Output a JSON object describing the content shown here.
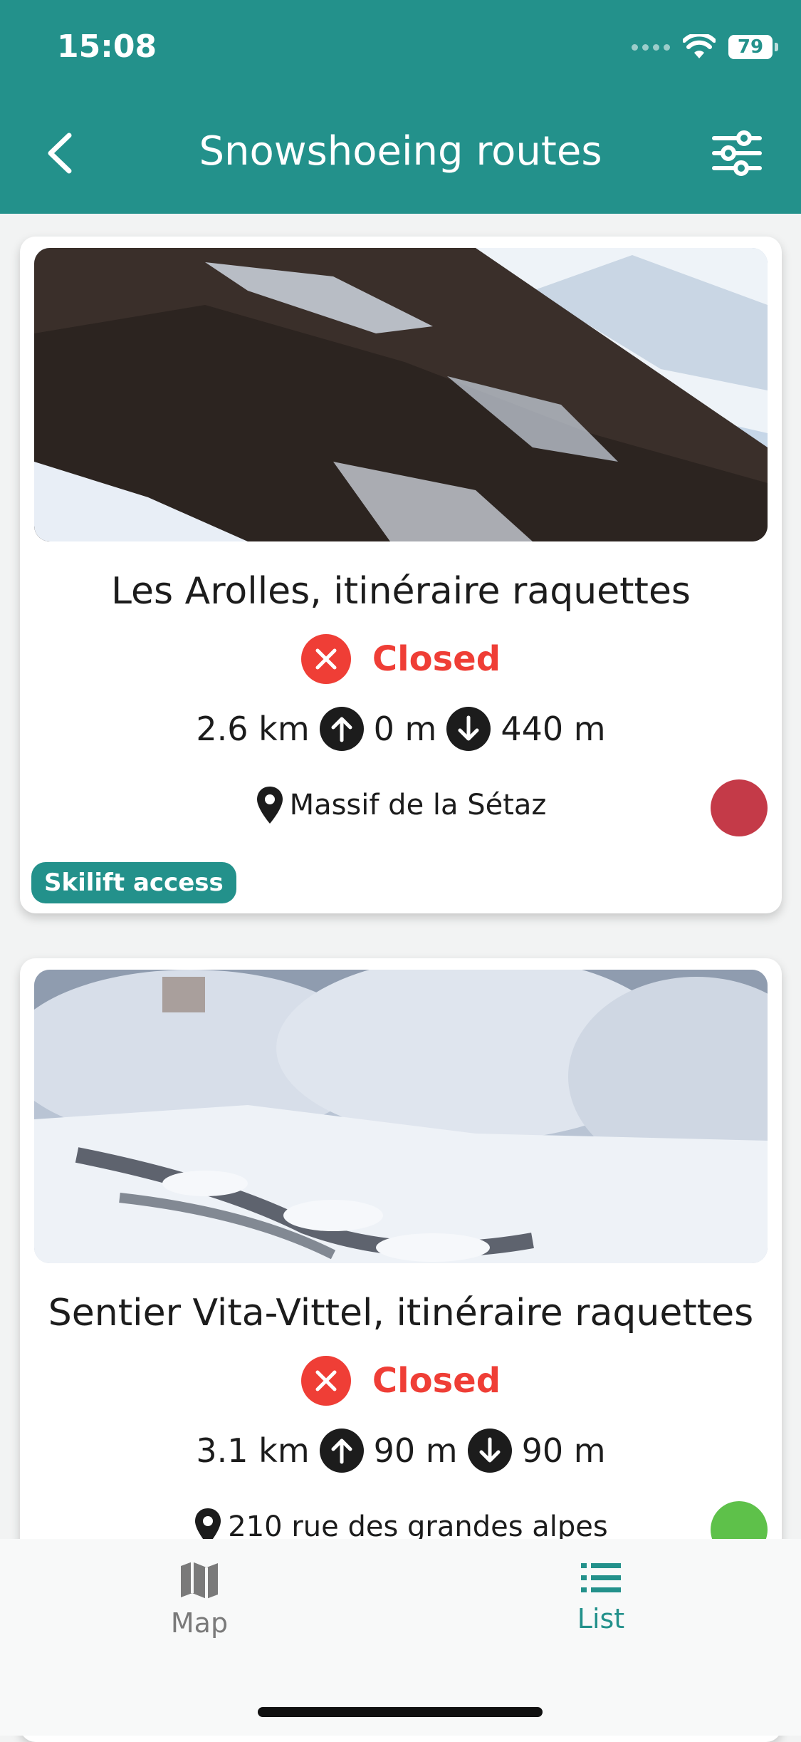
{
  "status_bar": {
    "time": "15:08",
    "battery": "79"
  },
  "nav": {
    "title": "Snowshoeing routes",
    "back_icon": "chevron-left-icon",
    "filter_icon": "sliders-icon"
  },
  "routes": [
    {
      "title": "Les Arolles, itinéraire raquettes",
      "status": "Closed",
      "distance": "2.6 km",
      "ascent": "0 m",
      "descent": "440 m",
      "location": "Massif de la Sétaz",
      "level_color": "#c43a48",
      "tag": "Skilift access"
    },
    {
      "title": "Sentier Vita-Vittel, itinéraire raquettes",
      "status": "Closed",
      "distance": "3.1 km",
      "ascent": "90 m",
      "descent": "90 m",
      "location": "210 rue des grandes alpes",
      "level_color": "#5ec14a"
    }
  ],
  "tabs": [
    {
      "label": "Map",
      "icon": "map-icon",
      "active": false
    },
    {
      "label": "List",
      "icon": "list-icon",
      "active": true
    }
  ],
  "colors": {
    "accent": "#23918b",
    "closed": "#ef3e36"
  }
}
